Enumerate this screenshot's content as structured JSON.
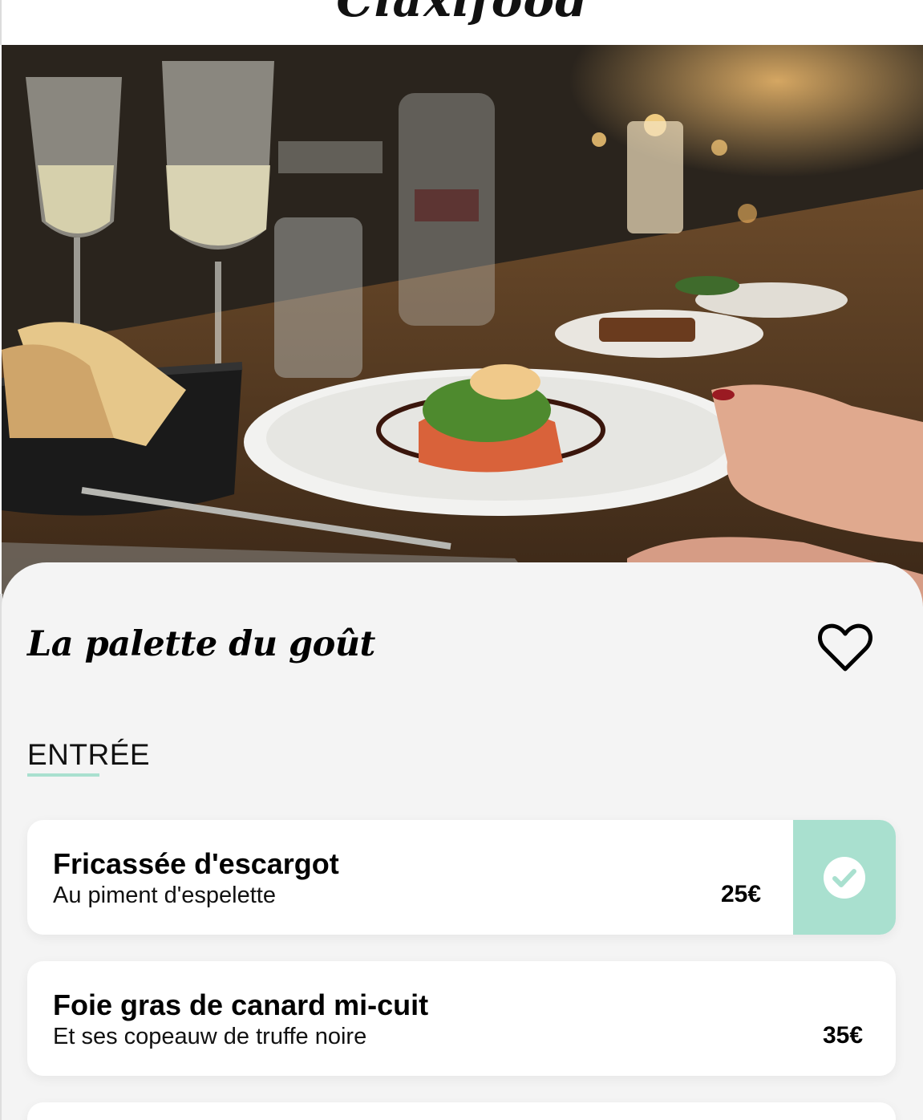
{
  "header": {
    "brand": "Claxifood"
  },
  "hero": {
    "alt_icon": "restaurant-photo"
  },
  "restaurant": {
    "name": "La palette du goût",
    "favorite_icon": "heart-outline-icon"
  },
  "menu": {
    "section_title": "ENTRÉE",
    "accent_color": "#a9e0cf",
    "items": [
      {
        "name": "Fricassée d'escargot",
        "description": "Au piment d'espelette",
        "price": "25€",
        "selected": true
      },
      {
        "name": "Foie gras de canard mi-cuit",
        "description": "Et ses copeauw de truffe noire",
        "price": "35€",
        "selected": false
      }
    ]
  }
}
